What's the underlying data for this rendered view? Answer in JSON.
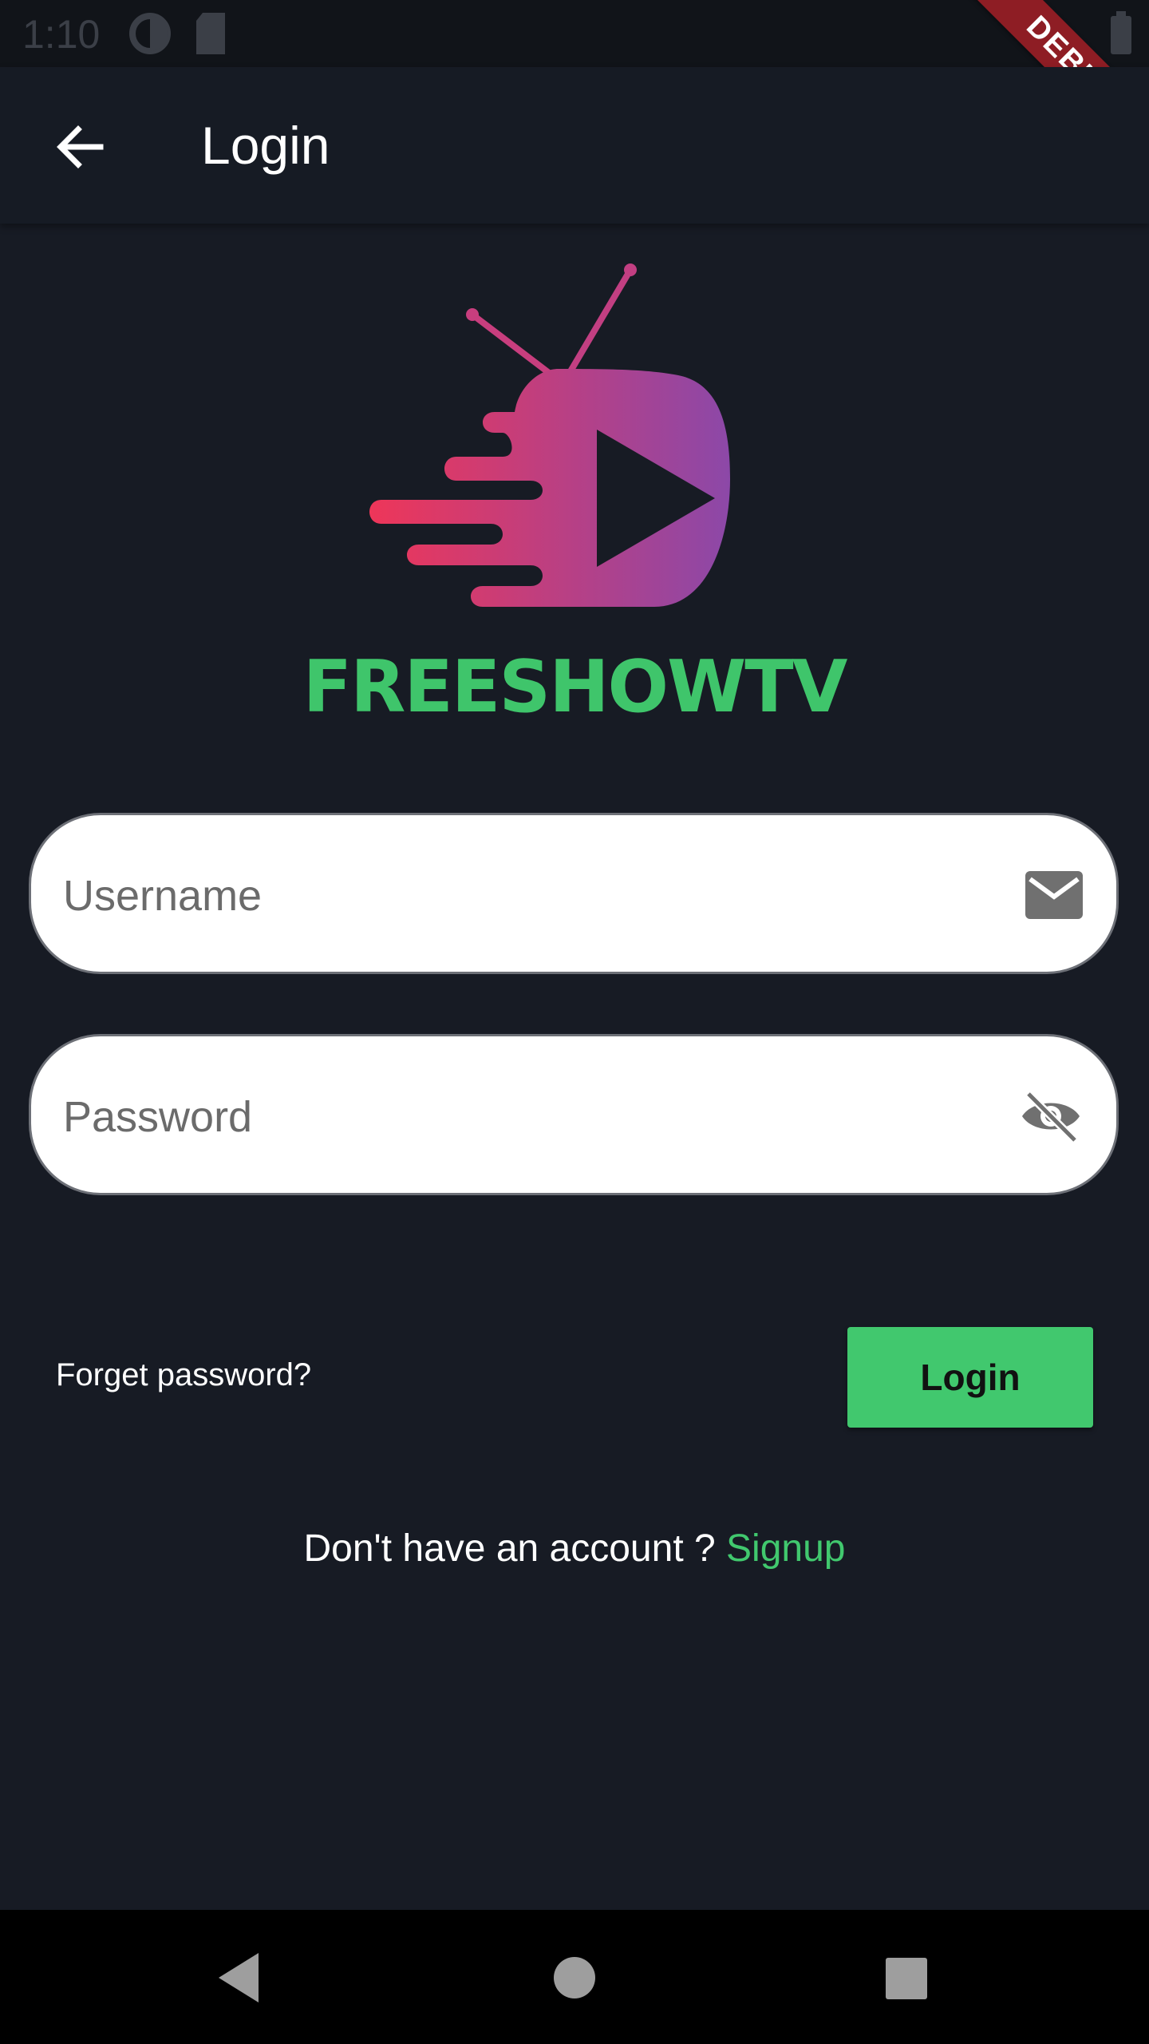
{
  "status_bar": {
    "time": "1:10"
  },
  "debug_banner": "DEBUG",
  "app_bar": {
    "title": "Login"
  },
  "brand": {
    "name": "FREESHOWTV",
    "name_color": "#3fc56b",
    "logo_gradient": [
      "#e9345a",
      "#8e48a6"
    ]
  },
  "form": {
    "username_placeholder": "Username",
    "password_placeholder": "Password",
    "forgot_password": "Forget password?",
    "login_button": "Login"
  },
  "signup": {
    "prompt": "Don't have an account ? ",
    "link": "Signup"
  },
  "icons": {
    "back": "arrow-left-icon",
    "username": "mail-icon",
    "password": "eye-off-icon",
    "nav": [
      "back-triangle-icon",
      "home-circle-icon",
      "recents-square-icon"
    ]
  },
  "colors": {
    "background": "#171b24",
    "accent": "#41c86e"
  }
}
